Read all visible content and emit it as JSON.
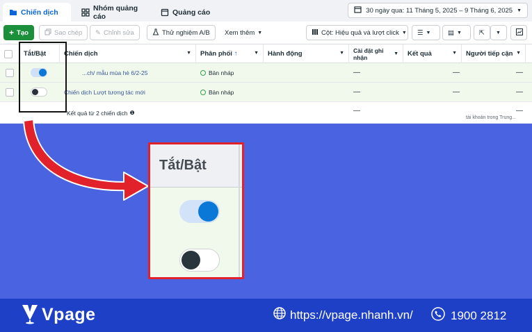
{
  "tabs": [
    {
      "label": "Chiến dịch",
      "icon": "folder-icon",
      "active": true
    },
    {
      "label": "Nhóm quảng cáo",
      "icon": "grid-icon",
      "active": false
    },
    {
      "label": "Quảng cáo",
      "icon": "ad-page-icon",
      "active": false
    }
  ],
  "date_range": "30 ngày qua: 11 Tháng 5, 2025 – 9 Tháng 6, 2025",
  "toolbar": {
    "create": "Tạo",
    "duplicate": "Sao chép",
    "edit": "Chỉnh sửa",
    "ab_test": "Thử nghiệm A/B",
    "more": "Xem thêm",
    "columns": "Cột: Hiệu quả và lượt click"
  },
  "table": {
    "headers": {
      "toggle": "Tắt/Bật",
      "campaign": "Chiến dịch",
      "delivery": "Phân phối",
      "actions": "Hành động",
      "attribution": "Cài đặt ghi nhận",
      "results": "Kết quả",
      "reach": "Người tiếp cận"
    },
    "rows": [
      {
        "toggle_on": true,
        "name": "...ch/ mẫu mùa hè 6/2-25",
        "delivery": "Bản nháp",
        "attribution": "—",
        "results": "—",
        "reach": "—"
      },
      {
        "toggle_on": false,
        "name": "Chiến dịch Lượt tương tác mới",
        "delivery": "Bản nháp",
        "attribution": "—",
        "results": "—",
        "reach": "—"
      }
    ],
    "total_label": "Kết quả từ 2 chiến dịch",
    "total_attribution": "—",
    "total_reach": "—",
    "total_note": "tài khoản trong Trung..."
  },
  "zoom": {
    "title": "Tắt/Bật"
  },
  "footer": {
    "brand": "Vpage",
    "website": "https://vpage.nhanh.vn/",
    "phone": "1900 2812"
  },
  "colors": {
    "background": "#4a63e0",
    "footer": "#1d40c6",
    "accent_red": "#e1222a",
    "toggle_on": "#0a78d6"
  }
}
